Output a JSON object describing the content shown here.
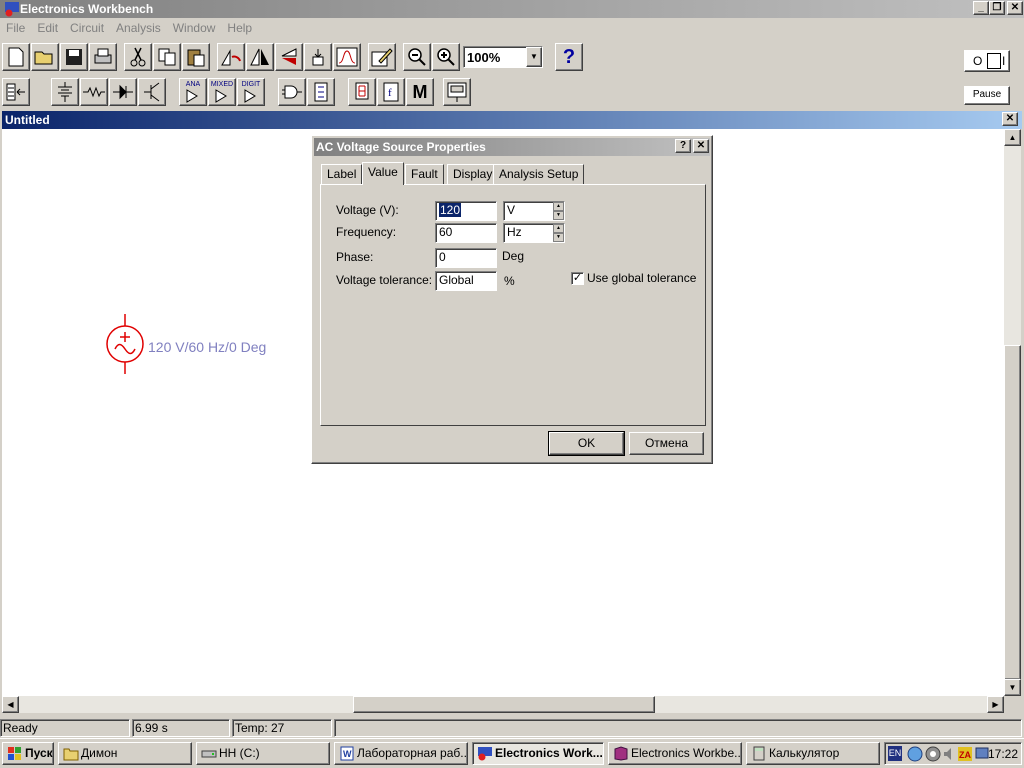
{
  "app": {
    "title": "Electronics Workbench"
  },
  "menu": [
    "File",
    "Edit",
    "Circuit",
    "Analysis",
    "Window",
    "Help"
  ],
  "toolbar": {
    "zoom": "100%",
    "help_glyph": "?",
    "pause_label": "Pause",
    "power_on": "O",
    "power_off": "I"
  },
  "parts_bin": {
    "analog_label": "ANA",
    "mixed_label": "MIXED",
    "digital_label": "DIGIT",
    "misc_label": "M"
  },
  "document": {
    "title": "Untitled"
  },
  "component": {
    "label": "120 V/60 Hz/0 Deg"
  },
  "dialog": {
    "title": "AC Voltage Source Properties",
    "tabs": [
      "Label",
      "Value",
      "Fault",
      "Display",
      "Analysis Setup"
    ],
    "active_tab": "Value",
    "fields": {
      "voltage_label": "Voltage (V):",
      "voltage_value": "120",
      "voltage_unit": "V",
      "frequency_label": "Frequency:",
      "frequency_value": "60",
      "frequency_unit": "Hz",
      "phase_label": "Phase:",
      "phase_value": "0",
      "phase_unit": "Deg",
      "tolerance_label": "Voltage tolerance:",
      "tolerance_value": "Global",
      "tolerance_unit": "%",
      "use_global_label": "Use global tolerance",
      "use_global_checked": true
    },
    "ok_label": "OK",
    "cancel_label": "Отмена"
  },
  "status": {
    "state": "Ready",
    "time": "6.99 s",
    "temp": "Temp:  27"
  },
  "taskbar": {
    "start_label": "Пуск",
    "tasks": [
      {
        "label": "Димон"
      },
      {
        "label": "HH (C:)"
      },
      {
        "label": "Лабораторная раб..."
      },
      {
        "label": "Electronics Work..."
      },
      {
        "label": "Electronics Workbe..."
      },
      {
        "label": "Калькулятор"
      }
    ],
    "lang": "EN",
    "clock": "17:22"
  }
}
